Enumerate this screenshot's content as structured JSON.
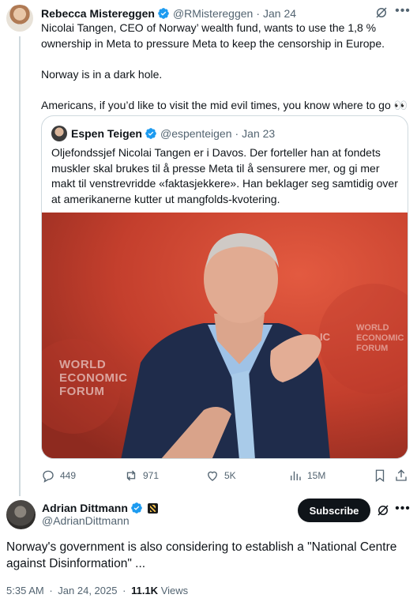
{
  "tweet1": {
    "author_name": "Rebecca Mistereggen",
    "handle": "@RMistereggen",
    "separator": "·",
    "date": "Jan 24",
    "text": "Nicolai Tangen, CEO of Norway’ wealth fund, wants to use the 1,8 % ownership in Meta to pressure Meta to keep the censorship in Europe.\n\nNorway is in a dark hole.\n\nAmericans, if you’d like to visit the mid evil times, you know where to go 👀",
    "quote": {
      "author_name": "Espen Teigen",
      "handle": "@espenteigen",
      "separator": "·",
      "date": "Jan 23",
      "text": "Oljefondssjef Nicolai Tangen er i Davos. Der forteller han at fondets muskler skal brukes til å presse Meta til å sensurere mer, og gi mer makt til venstrevridde «faktasjekkere». Han beklager seg samtidig over at amerikanerne kutter ut mangfolds-kvotering.",
      "photo_logo_left": "WORLD\nECONOMIC\nFORUM",
      "photo_logo_right": "WORLD\nECONOMIC\nFORUM",
      "photo_logo_partial": "IC"
    },
    "actions": {
      "replies": "449",
      "reposts": "971",
      "likes": "5K",
      "views": "15M"
    }
  },
  "tweet2": {
    "author_name": "Adrian Dittmann",
    "handle": "@AdrianDittmann",
    "subscribe_label": "Subscribe",
    "text": "Norway's government is also considering to establish a \"National Centre against Disinformation\" ...",
    "time": "5:35 AM",
    "separator": "·",
    "date": "Jan 24, 2025",
    "views_count": "11.1K",
    "views_label": "Views"
  },
  "colors": {
    "verified_blue": "#1d9bf0",
    "muted_text": "#536471",
    "border": "#cfd9de"
  },
  "icons": [
    "verified-badge-icon",
    "grok-icon",
    "more-icon",
    "reply-icon",
    "repost-icon",
    "like-icon",
    "views-icon",
    "bookmark-icon",
    "share-icon"
  ]
}
